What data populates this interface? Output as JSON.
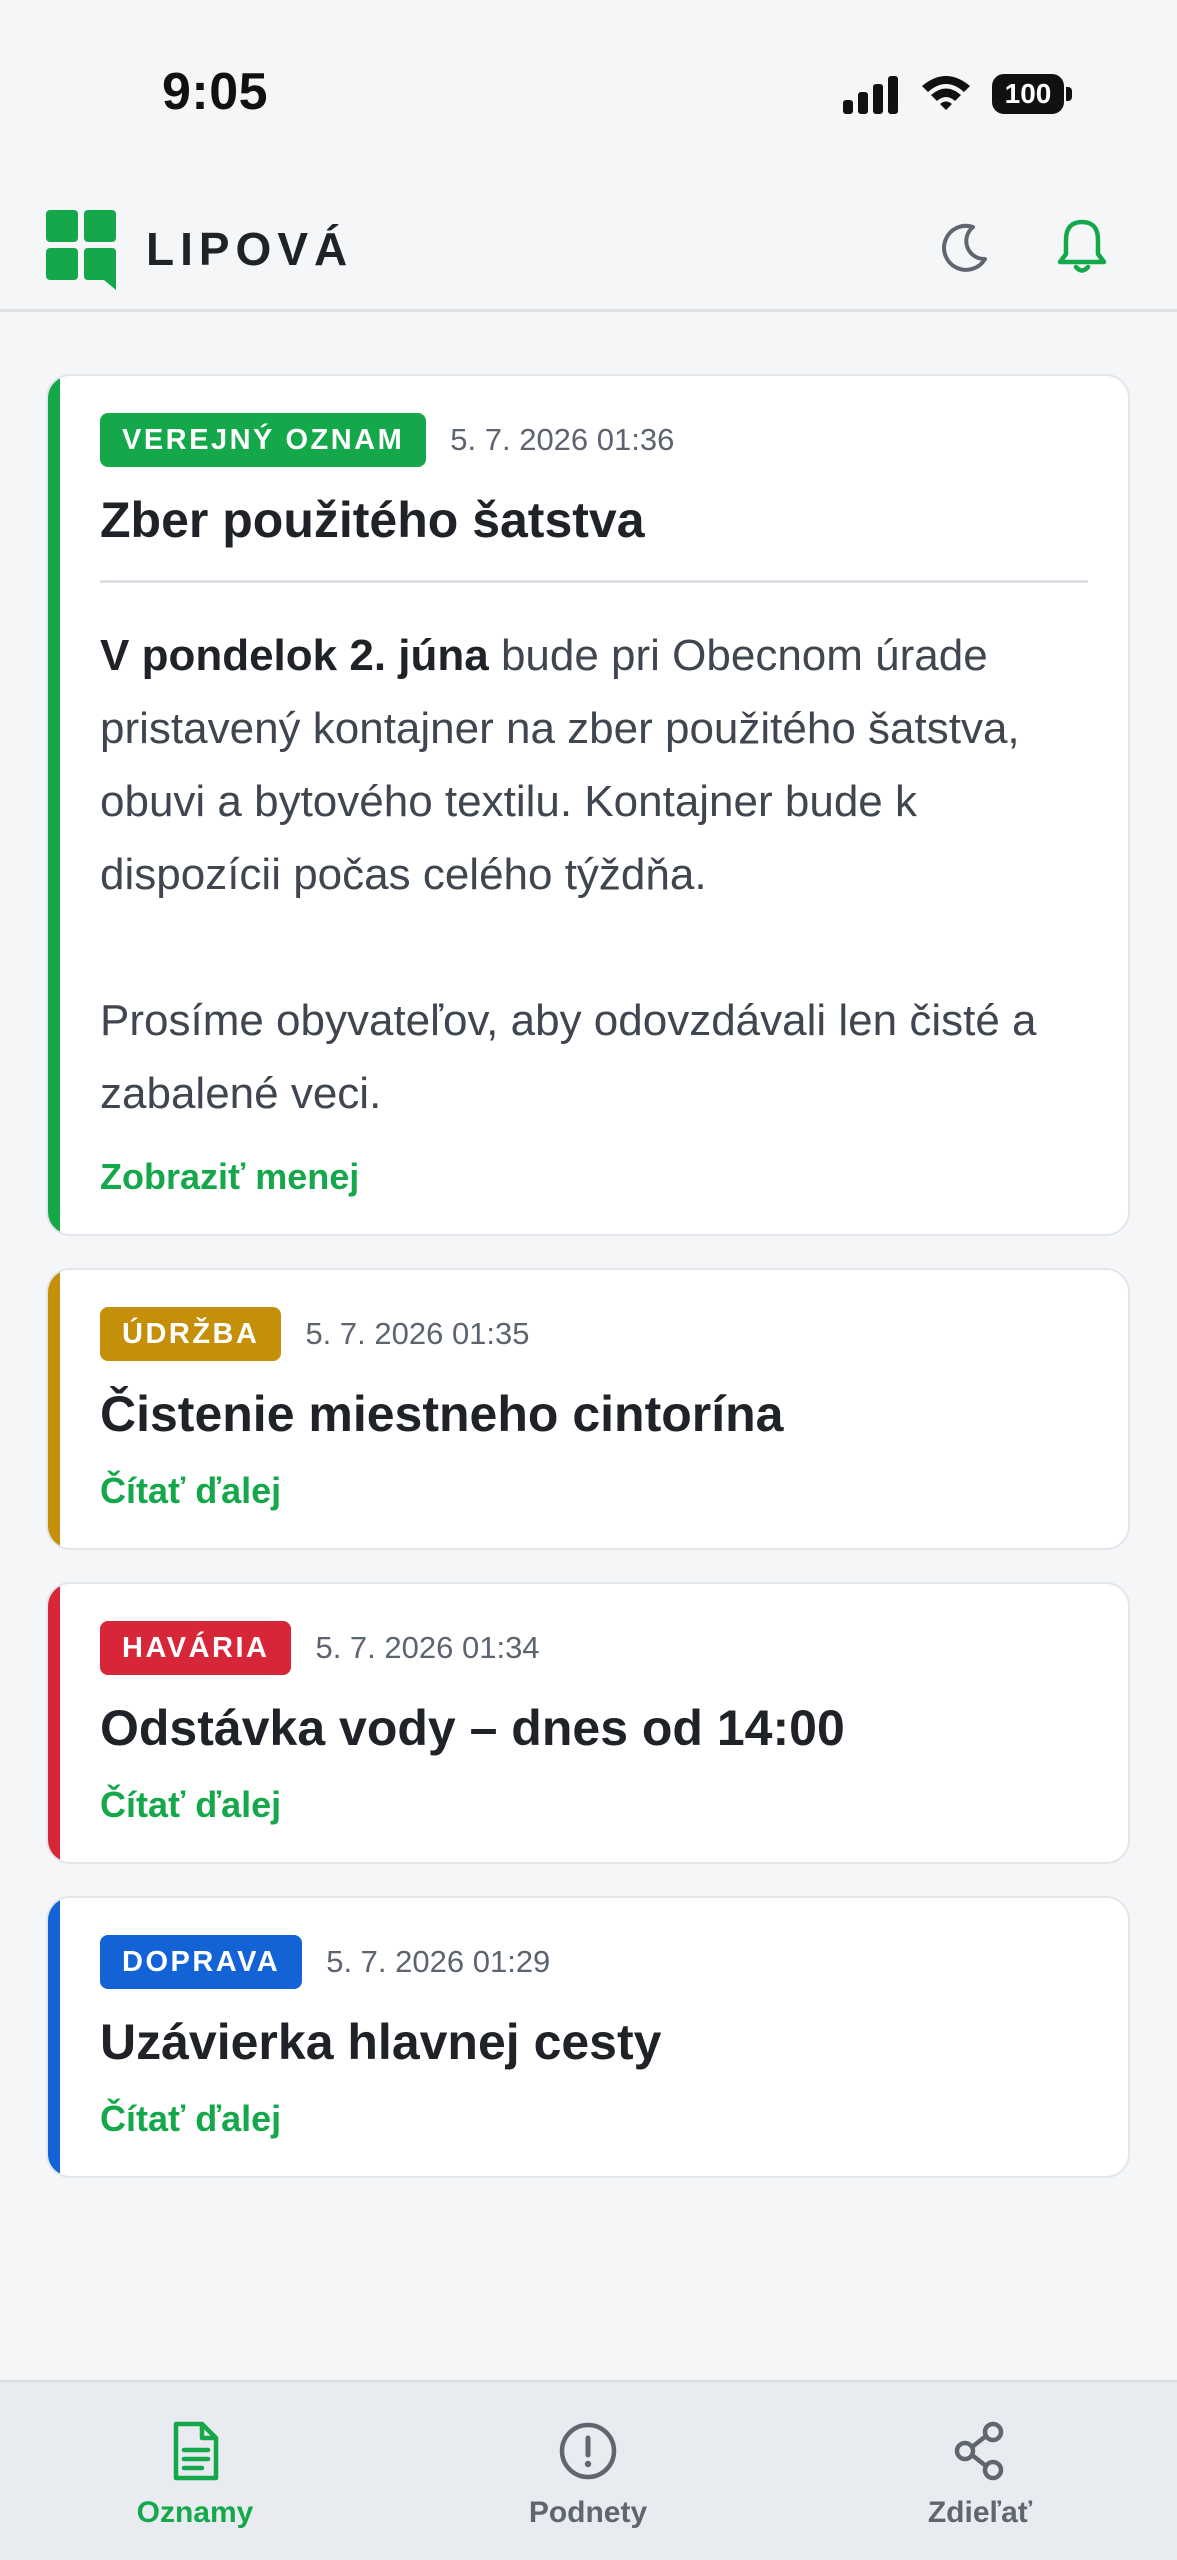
{
  "status_bar": {
    "time": "9:05",
    "battery": "100"
  },
  "header": {
    "app_name": "LIPOVÁ"
  },
  "colors": {
    "brand": "#14a84b",
    "verejny_oznam": "#14a84b",
    "udrzba": "#c58f0a",
    "havaria": "#d72638",
    "doprava": "#1363d6"
  },
  "cards": [
    {
      "category": "VEREJNÝ OZNAM",
      "date": "5. 7. 2026 01:36",
      "title": "Zber použitého šatstva",
      "body_strong": "V pondelok 2. júna",
      "body_rest": " bude pri Obecnom úrade pristavený kontajner na zber použitého šatstva, obuvi a bytového textilu. Kontajner bude k dispozícii počas celého týždňa.",
      "body_para2": "Prosíme obyvateľov, aby odovzdávali len čisté a zabalené veci.",
      "link": "Zobraziť menej"
    },
    {
      "category": "ÚDRŽBA",
      "date": "5. 7. 2026 01:35",
      "title": "Čistenie miestneho cintorína",
      "link": "Čítať ďalej"
    },
    {
      "category": "HAVÁRIA",
      "date": "5. 7. 2026 01:34",
      "title": "Odstávka vody – dnes od 14:00",
      "link": "Čítať ďalej"
    },
    {
      "category": "DOPRAVA",
      "date": "5. 7. 2026 01:29",
      "title": "Uzávierka hlavnej cesty",
      "link": "Čítať ďalej"
    }
  ],
  "bottom_nav": [
    {
      "label": "Oznamy",
      "icon": "document-icon",
      "active": true
    },
    {
      "label": "Podnety",
      "icon": "alert-circle-icon",
      "active": false
    },
    {
      "label": "Zdieľať",
      "icon": "share-icon",
      "active": false
    }
  ]
}
